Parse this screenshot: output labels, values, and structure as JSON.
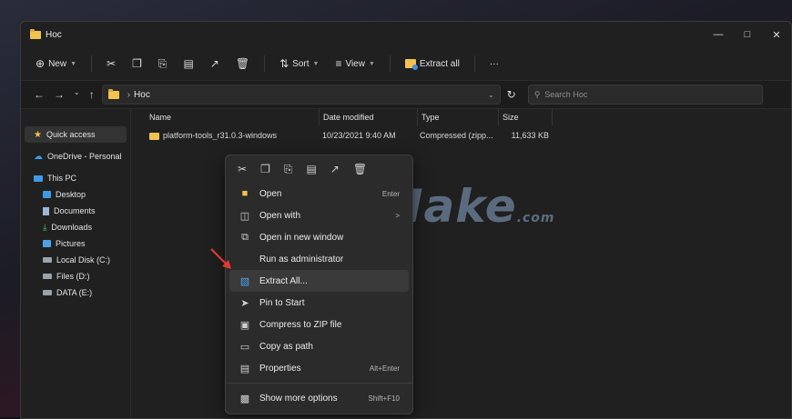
{
  "window": {
    "title": "Hoc"
  },
  "toolbar": {
    "new_label": "New",
    "sort_label": "Sort",
    "view_label": "View",
    "extract_all_label": "Extract all",
    "more_label": "···"
  },
  "address": {
    "path": "Hoc",
    "search_placeholder": "Search Hoc"
  },
  "sidebar": {
    "items": [
      {
        "label": "Quick access"
      },
      {
        "label": "OneDrive - Personal"
      },
      {
        "label": "This PC"
      },
      {
        "label": "Desktop"
      },
      {
        "label": "Documents"
      },
      {
        "label": "Downloads"
      },
      {
        "label": "Pictures"
      },
      {
        "label": "Local Disk (C:)"
      },
      {
        "label": "Files (D:)"
      },
      {
        "label": "DATA (E:)"
      }
    ]
  },
  "columns": [
    "Name",
    "Date modified",
    "Type",
    "Size"
  ],
  "files": [
    {
      "name": "platform-tools_r31.0.3-windows",
      "date": "10/23/2021 9:40 AM",
      "type": "Compressed (zipp...",
      "size": "11,633 KB"
    }
  ],
  "context_menu": {
    "items": [
      {
        "label": "Open",
        "shortcut": "Enter"
      },
      {
        "label": "Open with",
        "shortcut": ">"
      },
      {
        "label": "Open in new window",
        "shortcut": ""
      },
      {
        "label": "Run as administrator",
        "shortcut": ""
      },
      {
        "label": "Extract All...",
        "shortcut": ""
      },
      {
        "label": "Pin to Start",
        "shortcut": ""
      },
      {
        "label": "Compress to ZIP file",
        "shortcut": ""
      },
      {
        "label": "Copy as path",
        "shortcut": ""
      },
      {
        "label": "Properties",
        "shortcut": "Alt+Enter"
      },
      {
        "label": "Show more options",
        "shortcut": "Shift+F10"
      }
    ]
  },
  "watermark": {
    "main": "TipsMake",
    "suffix": ".com"
  },
  "colors": {
    "folder": "#f3c24f",
    "accent": "#3c9be8",
    "arrow": "#e53935"
  }
}
